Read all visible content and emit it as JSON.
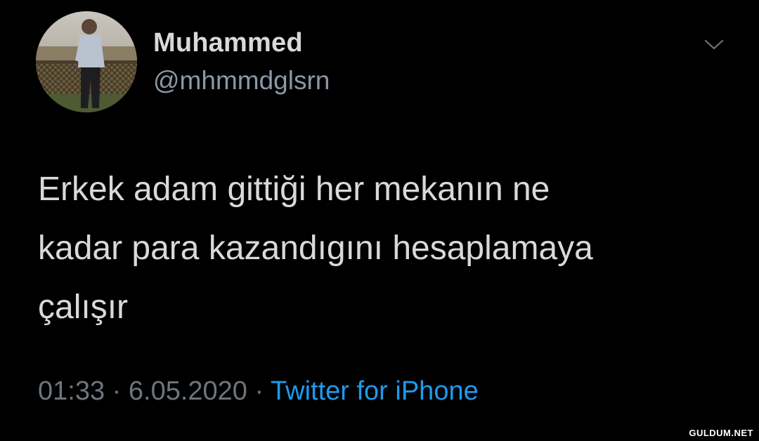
{
  "author": {
    "display_name": "Muhammed",
    "handle": "@mhmmdglsrn"
  },
  "tweet": {
    "lines": [
      "Erkek adam gittiği her mekanın ne",
      "kadar para kazandıgını hesaplamaya",
      "çalışır"
    ]
  },
  "meta": {
    "time": "01:33",
    "separator": "·",
    "date": "6.05.2020",
    "source": "Twitter for iPhone"
  },
  "watermark": "GULDUM.NET",
  "icons": {
    "menu": "chevron-down-icon"
  },
  "colors": {
    "background": "#000000",
    "text": "#d9d9d9",
    "secondary": "#8b98a5",
    "meta": "#6e767d",
    "link": "#1d9bf0"
  }
}
